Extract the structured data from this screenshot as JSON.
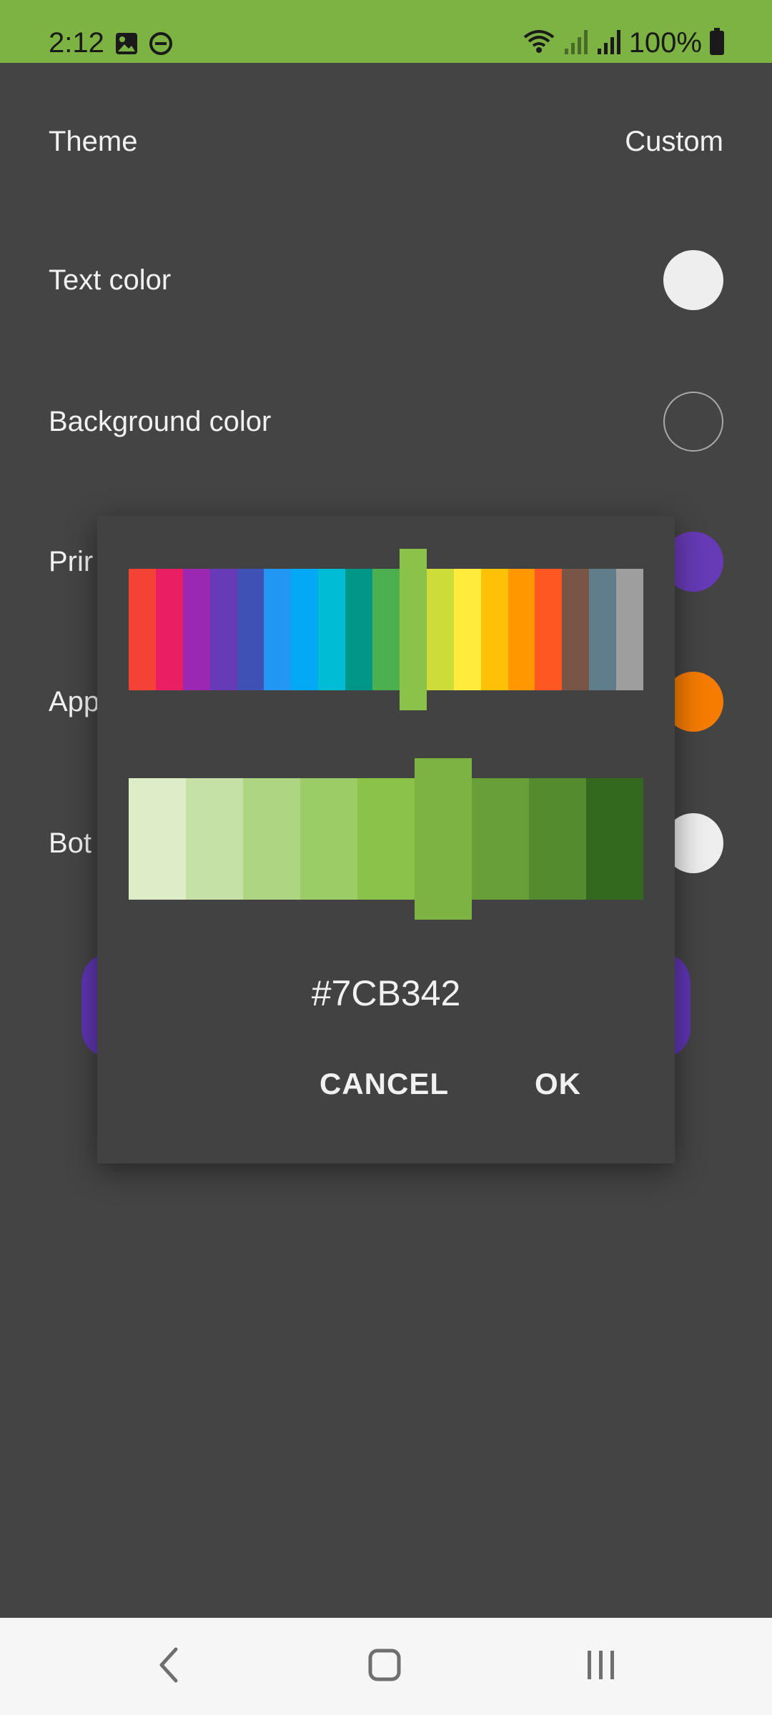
{
  "status_bar": {
    "time": "2:12",
    "battery": "100%",
    "left_icons": [
      "image-icon",
      "do-not-disturb-icon"
    ],
    "right_icons": [
      "wifi-icon",
      "signal-icon",
      "signal-icon",
      "battery-icon"
    ],
    "color": "#7CB342"
  },
  "settings": {
    "theme_label": "Theme",
    "theme_value": "Custom",
    "text_color_label": "Text color",
    "background_color_label": "Background color",
    "primary_label_partial": "Prir",
    "app_label_partial": "App",
    "bottom_label_partial": "Bot"
  },
  "dialog": {
    "hue_colors": [
      "#F44336",
      "#E91E63",
      "#9C27B0",
      "#673AB7",
      "#3F51B5",
      "#2196F3",
      "#03A9F4",
      "#00BCD4",
      "#009688",
      "#4CAF50",
      "#8BC34A",
      "#CDDC39",
      "#FFEB3B",
      "#FFC107",
      "#FF9800",
      "#FF5722",
      "#795548",
      "#607D8B",
      "#9E9E9E"
    ],
    "selected_hue": "#8BC34A",
    "shade_colors": [
      "#DCEDC8",
      "#C5E1A5",
      "#AED581",
      "#9CCC65",
      "#8BC34A",
      "#7CB342",
      "#689F38",
      "#558B2F",
      "#33691E"
    ],
    "selected_shade": "#7CB342",
    "hex_value": "#7CB342",
    "cancel_label": "CANCEL",
    "ok_label": "OK"
  },
  "nav_bar": {
    "icons": [
      "back-icon",
      "home-icon",
      "recents-icon"
    ]
  }
}
